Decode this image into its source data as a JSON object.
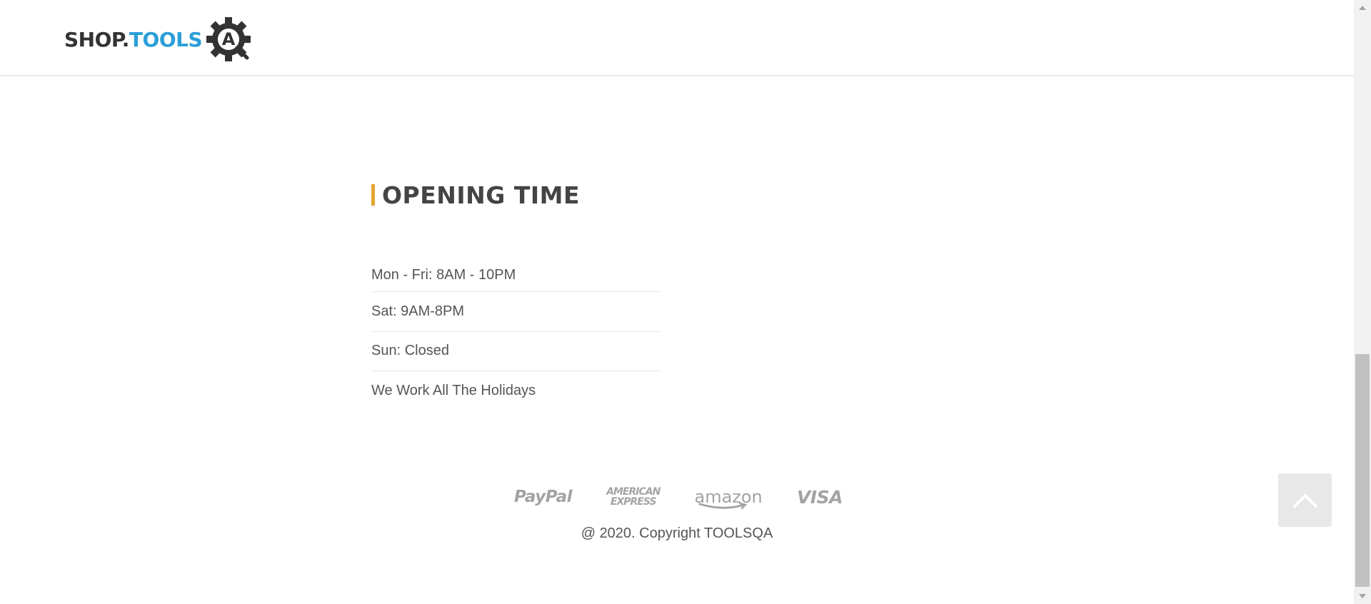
{
  "header": {
    "logo_text_shop": "SHOP.",
    "logo_text_tools": "TOOLS",
    "logo_badge_letter": "A"
  },
  "opening": {
    "title": "OPENING TIME",
    "items": [
      "Mon - Fri: 8AM - 10PM",
      "Sat: 9AM-8PM",
      "Sun: Closed",
      "We Work All The Holidays"
    ]
  },
  "footer": {
    "payments": {
      "paypal": "PayPal",
      "amex_line1": "AMERICAN",
      "amex_line2": "EXPRESS",
      "amazon": "amazon",
      "visa": "VISA"
    },
    "copyright": "@ 2020. Copyright TOOLSQA"
  },
  "colors": {
    "accent": "#e4a530",
    "brand_blue": "#2a9fd8",
    "text": "#555555",
    "payment_gray": "#a3a3a3"
  },
  "icons": {
    "back_to_top": "chevron-up-icon",
    "logo": "gear-icon"
  }
}
